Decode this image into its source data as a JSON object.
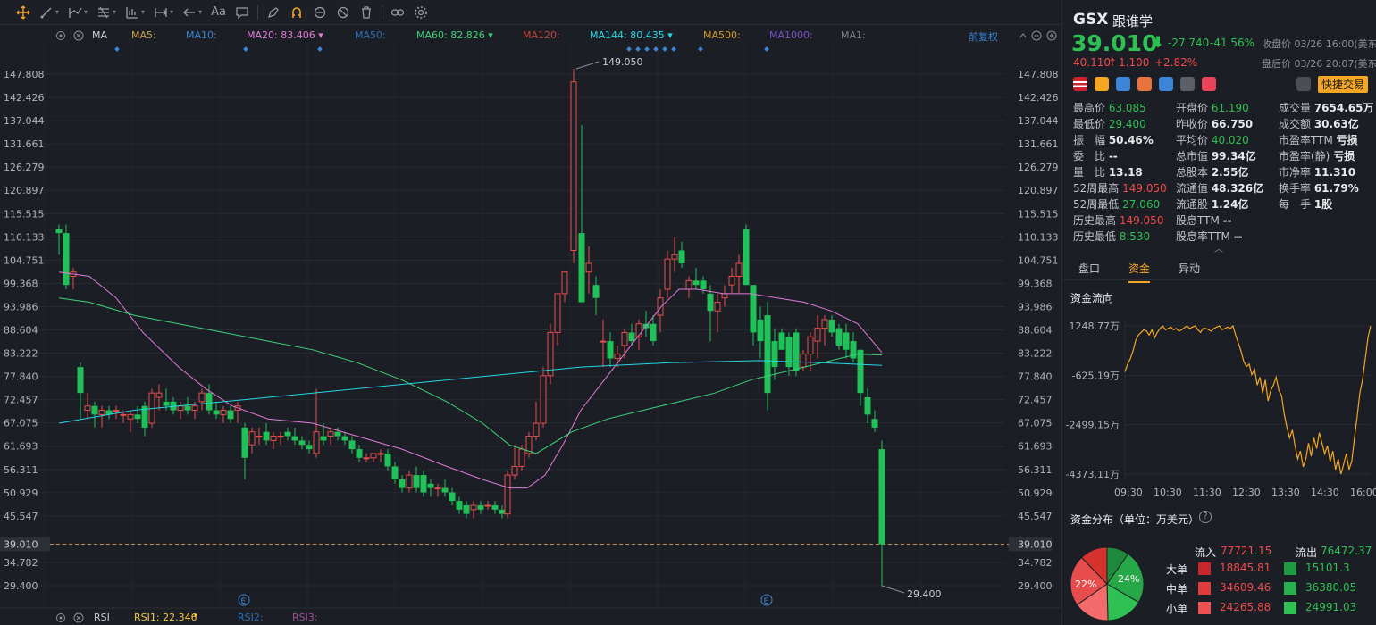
{
  "toolbar": {
    "icons": [
      "crosshair-icon",
      "line-tool-icon",
      "trend-tool-icon",
      "fib-tool-icon",
      "pattern-tool-icon",
      "measure-tool-icon",
      "arrow-tool-icon",
      "text-tool-icon",
      "note-tool-icon",
      "pencil-icon",
      "magnet-icon",
      "eye-lock-icon",
      "eye-hide-icon",
      "trash-icon",
      "link-icon",
      "settings-icon"
    ],
    "text_tool": "Aa"
  },
  "ma_legend": {
    "label": "MA",
    "items": [
      {
        "name": "MA5:",
        "value": "",
        "color": "#c8a24a"
      },
      {
        "name": "MA10:",
        "value": "",
        "color": "#3b86d6"
      },
      {
        "name": "MA20:",
        "value": "83.406",
        "color": "#e07ad8"
      },
      {
        "name": "MA50:",
        "value": "",
        "color": "#2f6fb5"
      },
      {
        "name": "MA60:",
        "value": "82.826",
        "color": "#3fd17a"
      },
      {
        "name": "MA120:",
        "value": "",
        "color": "#c0443c"
      },
      {
        "name": "MA144:",
        "value": "80.435",
        "color": "#27d6e6"
      },
      {
        "name": "MA500:",
        "value": "",
        "color": "#d49a2a"
      },
      {
        "name": "MA1000:",
        "value": "",
        "color": "#7a52c8"
      },
      {
        "name": "MA1:",
        "value": "",
        "color": "#7d838c"
      }
    ],
    "restore": "前复权"
  },
  "rsi_legend": {
    "label": "RSI",
    "rsi1": "RSI1: 22.346",
    "rsi2": "RSI2:",
    "rsi3": "RSI3:"
  },
  "chart": {
    "price_ticks": [
      "147.808",
      "142.426",
      "137.044",
      "131.661",
      "126.279",
      "120.897",
      "115.515",
      "110.133",
      "104.751",
      "99.368",
      "93.986",
      "88.604",
      "83.222",
      "77.840",
      "72.457",
      "67.075",
      "61.693",
      "56.311",
      "50.929",
      "45.547",
      "39.010",
      "34.782",
      "29.400"
    ],
    "current_price": "39.010",
    "high_label": "149.050",
    "low_label": "29.400",
    "event_marker": "E"
  },
  "quote": {
    "ticker": "GSX",
    "name": "跟谁学",
    "price": "39.010",
    "arrow": "⬇",
    "change": "-27.740",
    "change_pct": "-41.56%",
    "close_time": "收盘价 03/26 16:00(美东)",
    "after_price": "40.110",
    "after_arrow": "↑",
    "after_change": "1.100",
    "after_pct": "+2.82%",
    "after_time": "盘后价 03/26 20:07(美东)",
    "quick_trade": "快捷交易"
  },
  "stats": [
    [
      {
        "k": "最高价",
        "v": "63.085",
        "c": "green"
      },
      {
        "k": "开盘价",
        "v": "61.190",
        "c": "green"
      },
      {
        "k": "成交量",
        "v": "7654.65万",
        "c": "white"
      }
    ],
    [
      {
        "k": "最低价",
        "v": "29.400",
        "c": "green"
      },
      {
        "k": "昨收价",
        "v": "66.750",
        "c": "white"
      },
      {
        "k": "成交额",
        "v": "30.63亿",
        "c": "white"
      }
    ],
    [
      {
        "k": "振　幅",
        "v": "50.46%",
        "c": "white"
      },
      {
        "k": "平均价",
        "v": "40.020",
        "c": "green"
      },
      {
        "k": "市盈率TTM",
        "v": "亏损",
        "c": "white"
      }
    ],
    [
      {
        "k": "委　比",
        "v": "--",
        "c": "white"
      },
      {
        "k": "总市值",
        "v": "99.34亿",
        "c": "white"
      },
      {
        "k": "市盈率(静)",
        "v": "亏损",
        "c": "white"
      }
    ],
    [
      {
        "k": "量　比",
        "v": "13.18",
        "c": "white"
      },
      {
        "k": "总股本",
        "v": "2.55亿",
        "c": "white"
      },
      {
        "k": "市净率",
        "v": "11.310",
        "c": "white"
      }
    ],
    [
      {
        "k": "52周最高",
        "v": "149.050",
        "c": "red"
      },
      {
        "k": "流通值",
        "v": "48.326亿",
        "c": "white"
      },
      {
        "k": "换手率",
        "v": "61.79%",
        "c": "white"
      }
    ],
    [
      {
        "k": "52周最低",
        "v": "27.060",
        "c": "green"
      },
      {
        "k": "流通股",
        "v": "1.24亿",
        "c": "white"
      },
      {
        "k": "每　手",
        "v": "1股",
        "c": "white"
      }
    ],
    [
      {
        "k": "历史最高",
        "v": "149.050",
        "c": "red"
      },
      {
        "k": "股息TTM",
        "v": "--",
        "c": "white"
      },
      {
        "k": "",
        "v": "",
        "c": "white"
      }
    ],
    [
      {
        "k": "历史最低",
        "v": "8.530",
        "c": "green"
      },
      {
        "k": "股息率TTM",
        "v": "--",
        "c": "white"
      },
      {
        "k": "",
        "v": "",
        "c": "white"
      }
    ]
  ],
  "tabs": [
    "盘口",
    "资金",
    "异动"
  ],
  "active_tab": 1,
  "fund_flow": {
    "title": "资金流向",
    "y_ticks": [
      "1248.77万",
      "-625.19万",
      "-2499.15万",
      "-4373.11万"
    ],
    "x_ticks": [
      "09:30",
      "10:30",
      "11:30",
      "12:30",
      "13:30",
      "14:30",
      "16:00"
    ]
  },
  "distribution": {
    "title": "资金分布（单位：万美元）",
    "inflow_label": "流入",
    "inflow_total": "77721.15",
    "outflow_label": "流出",
    "outflow_total": "76472.37",
    "rows": [
      {
        "label": "大单",
        "in": "18845.81",
        "out": "15101.3"
      },
      {
        "label": "中单",
        "in": "34609.46",
        "out": "36380.05"
      },
      {
        "label": "小单",
        "in": "24265.88",
        "out": "24991.03"
      }
    ],
    "pie_left": "22%",
    "pie_right": "24%"
  }
}
